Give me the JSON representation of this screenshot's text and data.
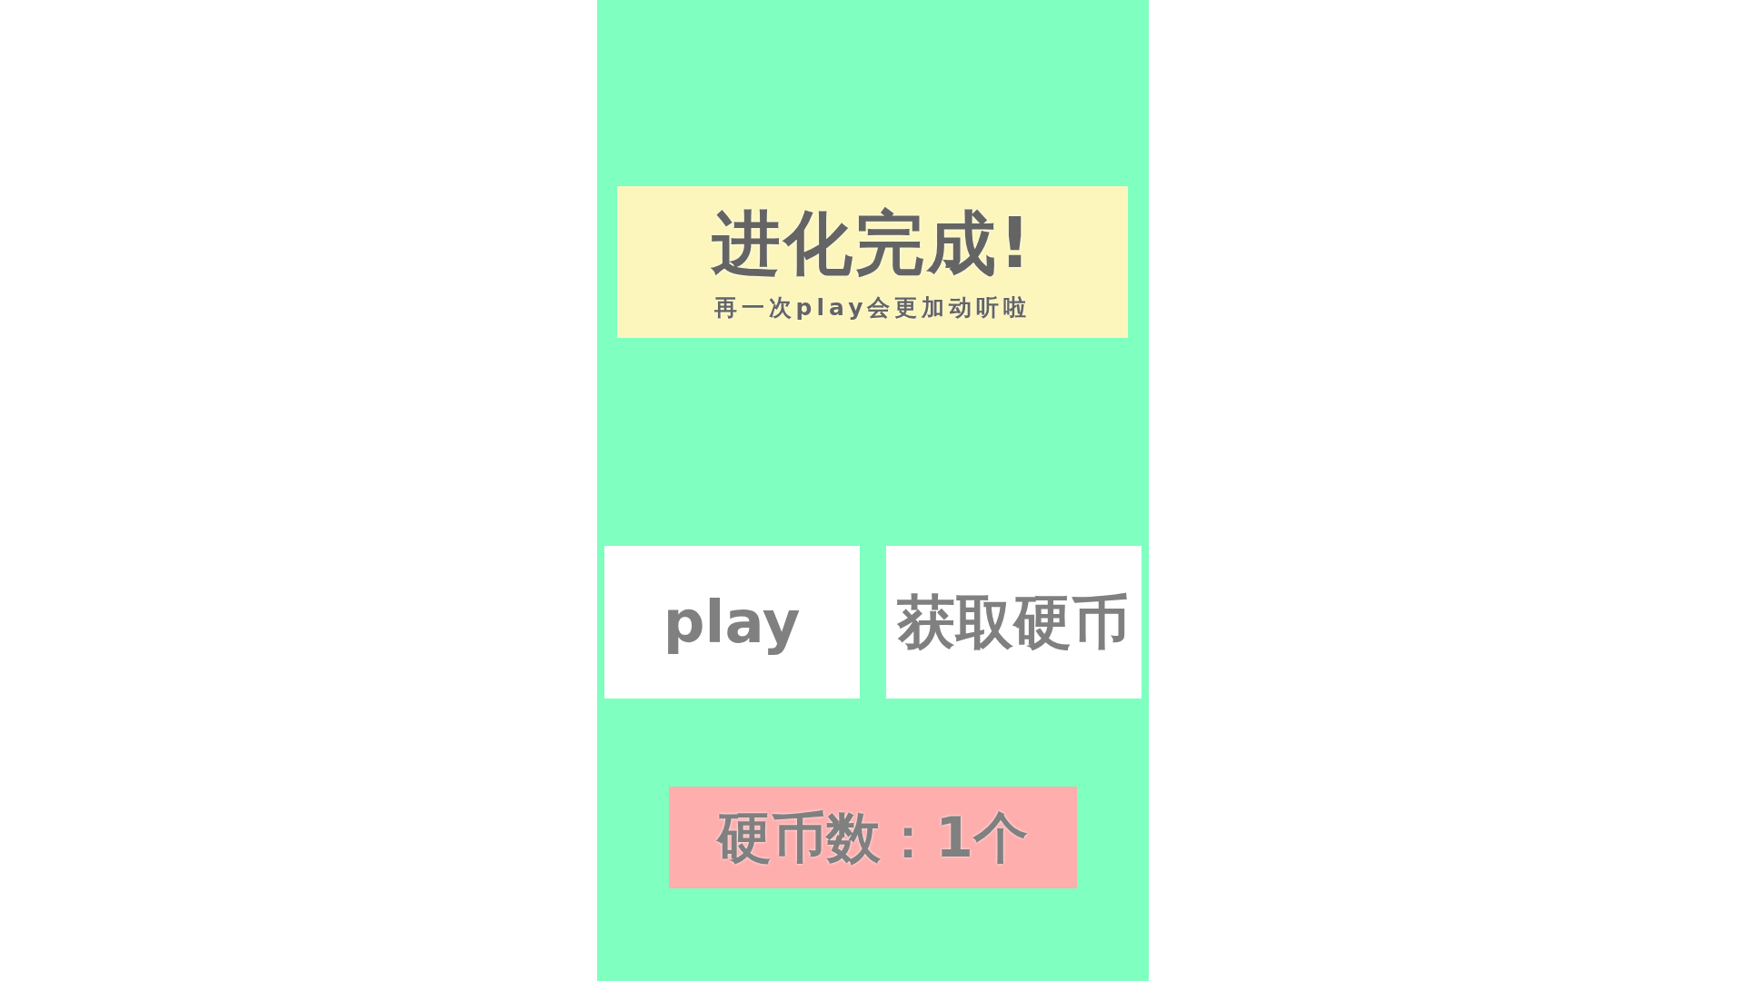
{
  "banner": {
    "title": "进化完成!",
    "subtitle": "再一次play会更加动听啦"
  },
  "buttons": [
    {
      "label": "play"
    },
    {
      "label": "获取硬币"
    }
  ],
  "coin_counter": {
    "label": "硬币数：1个"
  }
}
